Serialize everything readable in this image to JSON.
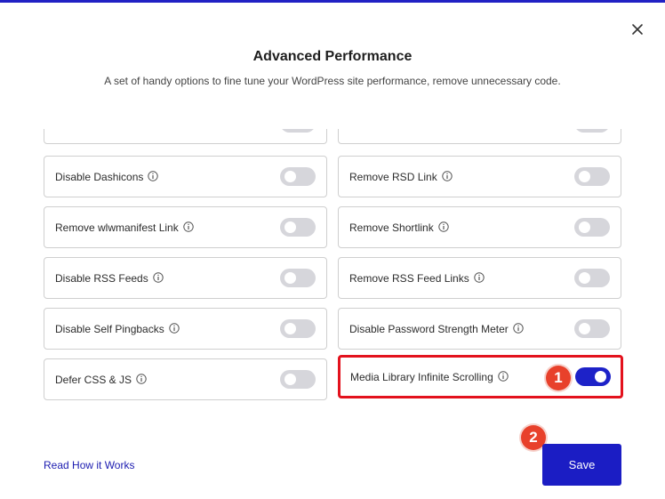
{
  "header": {
    "title": "Advanced Performance",
    "subtitle": "A set of handy options to fine tune your WordPress site performance, remove unnecessary code."
  },
  "options": [
    {
      "label": "Disable Dashicons",
      "enabled": false
    },
    {
      "label": "Remove RSD Link",
      "enabled": false
    },
    {
      "label": "Remove wlwmanifest Link",
      "enabled": false
    },
    {
      "label": "Remove Shortlink",
      "enabled": false
    },
    {
      "label": "Disable RSS Feeds",
      "enabled": false
    },
    {
      "label": "Remove RSS Feed Links",
      "enabled": false
    },
    {
      "label": "Disable Self Pingbacks",
      "enabled": false
    },
    {
      "label": "Disable Password Strength Meter",
      "enabled": false
    },
    {
      "label": "Defer CSS & JS",
      "enabled": false
    },
    {
      "label": "Media Library Infinite Scrolling",
      "enabled": true
    }
  ],
  "annotations": {
    "step1": "1",
    "step2": "2"
  },
  "footer": {
    "read_link": "Read How it Works",
    "save_label": "Save"
  },
  "colors": {
    "accent": "#1d22c8",
    "toggle_off": "#d6d6db",
    "highlight": "#e3121d",
    "badge": "#e8412b"
  },
  "icons": {
    "close": "close-icon",
    "info": "info-icon"
  }
}
